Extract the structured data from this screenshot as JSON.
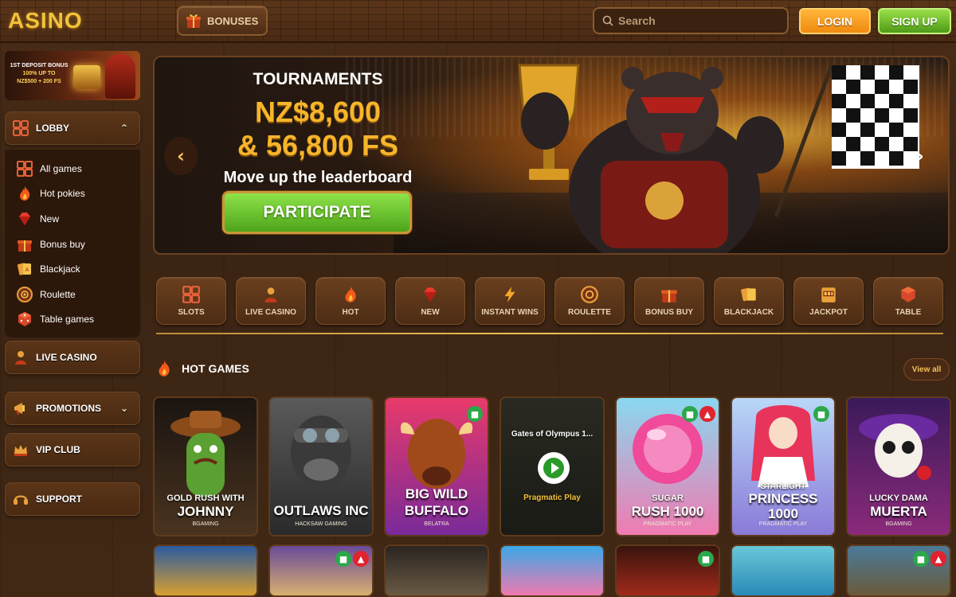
{
  "header": {
    "logo": "ASINO",
    "bonuses_label": "BONUSES",
    "search_placeholder": "Search",
    "login_label": "LOGIN",
    "signup_label": "SIGN UP"
  },
  "sidebar": {
    "promo": {
      "line1": "1ST DEPOSIT BONUS",
      "line2": "100% UP TO",
      "line3": "NZ$500 + 200 FS"
    },
    "lobby_label": "LOBBY",
    "lobby_items": [
      {
        "label": "All games",
        "icon": "grid-icon"
      },
      {
        "label": "Hot pokies",
        "icon": "fire-icon"
      },
      {
        "label": "New",
        "icon": "diamond-icon"
      },
      {
        "label": "Bonus buy",
        "icon": "gift-icon"
      },
      {
        "label": "Blackjack",
        "icon": "cards-icon"
      },
      {
        "label": "Roulette",
        "icon": "roulette-icon"
      },
      {
        "label": "Table games",
        "icon": "dice-icon"
      }
    ],
    "live_casino": "LIVE CASINO",
    "promotions": "PROMOTIONS",
    "vip_club": "VIP CLUB",
    "support": "SUPPORT"
  },
  "banner": {
    "title": "TOURNAMENTS",
    "amount_line1": "NZ$8,600",
    "amount_line2": "& 56,800 FS",
    "subtitle": "Move up the leaderboard",
    "cta": "PARTICIPATE"
  },
  "categories": [
    {
      "label": "SLOTS",
      "icon": "slots-grid-icon"
    },
    {
      "label": "LIVE CASINO",
      "icon": "dealer-icon"
    },
    {
      "label": "HOT",
      "icon": "fire-icon"
    },
    {
      "label": "NEW",
      "icon": "diamond-icon"
    },
    {
      "label": "INSTANT WINS",
      "icon": "lightning-icon"
    },
    {
      "label": "ROULETTE",
      "icon": "roulette-icon"
    },
    {
      "label": "BONUS BUY",
      "icon": "gift-icon"
    },
    {
      "label": "BLACKJACK",
      "icon": "cards-icon"
    },
    {
      "label": "JACKPOT",
      "icon": "slot-machine-icon"
    },
    {
      "label": "TABLE",
      "icon": "dice-icon"
    }
  ],
  "hot_games": {
    "title": "HOT GAMES",
    "view_all": "View all",
    "games": [
      {
        "line1": "GOLD RUSH WITH",
        "line2": "JOHNNY",
        "provider": "BGAMING",
        "bg": "#3a2a1a"
      },
      {
        "line1": "",
        "line2": "OUTLAWS INC",
        "provider": "HACKSAW GAMING",
        "bg": "#4a4a4a"
      },
      {
        "line1": "",
        "line2": "BIG WILD BUFFALO",
        "provider": "BELATRA",
        "bg": "#c8245a"
      },
      {
        "line1": "Gates of Olympus 1...",
        "line2": "Pragmatic Play",
        "provider": "",
        "bg": "#2a2a22"
      },
      {
        "line1": "SUGAR",
        "line2": "RUSH 1000",
        "provider": "PRAGMATIC PLAY",
        "bg": "#f07ab0"
      },
      {
        "line1": "STARLIGHT",
        "line2": "PRINCESS 1000",
        "provider": "PRAGMATIC PLAY",
        "bg": "#8a7ad8"
      },
      {
        "line1": "LUCKY DAMA",
        "line2": "MUERTA",
        "provider": "BGAMING",
        "bg": "#6a2a8a"
      }
    ]
  },
  "colors": {
    "accent_gold": "#f7b52a",
    "login": "#f08a10",
    "signup": "#4e9a17",
    "participate": "#4ea41a"
  }
}
